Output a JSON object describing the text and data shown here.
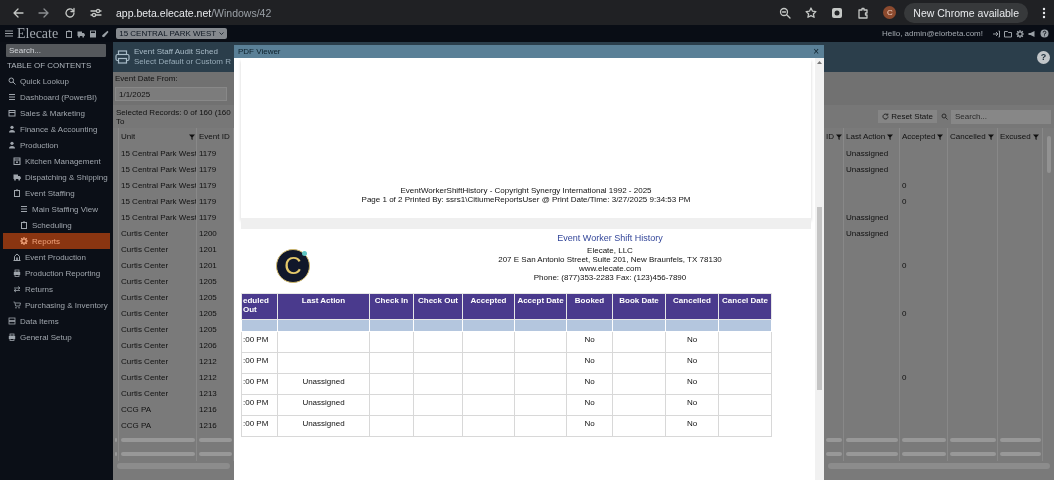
{
  "browser": {
    "address_host": "app.beta.elecate.net",
    "address_path": "/Windows/42",
    "profile_initial": "C",
    "update_button": "New Chrome available"
  },
  "app_header": {
    "logo": "Elecate",
    "location_dropdown": "15 CENTRAL PARK WEST",
    "greeting": "Hello, admin@elorbeta.com!"
  },
  "sidebar": {
    "search_placeholder": "Search...",
    "heading": "TABLE OF CONTENTS",
    "items": [
      {
        "label": "Quick Lookup",
        "selected": false
      },
      {
        "label": "Dashboard (PowerBI)",
        "selected": false
      },
      {
        "label": "Sales & Marketing",
        "selected": false
      },
      {
        "label": "Finance & Accounting",
        "selected": false
      },
      {
        "label": "Production",
        "selected": false,
        "children": [
          {
            "label": "Kitchen Management",
            "selected": false
          },
          {
            "label": "Dispatching & Shipping",
            "selected": false
          },
          {
            "label": "Event Staffing",
            "selected": false,
            "children": [
              {
                "label": "Main Staffing View",
                "selected": false
              },
              {
                "label": "Scheduling",
                "selected": false
              },
              {
                "label": "Reports",
                "selected": true
              }
            ]
          },
          {
            "label": "Event Production",
            "selected": false
          },
          {
            "label": "Production Reporting",
            "selected": false
          },
          {
            "label": "Returns",
            "selected": false
          },
          {
            "label": "Purchasing & Inventory",
            "selected": false
          }
        ]
      },
      {
        "label": "Data Items",
        "selected": false
      },
      {
        "label": "General Setup",
        "selected": false
      }
    ]
  },
  "report": {
    "title": "Event Staff Audit Sched",
    "subtitle": "Select Default or Custom R",
    "help_button": "?",
    "date_filter": {
      "label": "Event Date From:",
      "value": "1/1/2025"
    },
    "records_summary": "Selected Records: 0 of 160 (160 To",
    "reset_button": "Reset State",
    "search_placeholder": "Search...",
    "left_columns": [
      {
        "label": "Unit",
        "filter": true
      },
      {
        "label": "Event ID",
        "filter": false
      }
    ],
    "right_columns": [
      {
        "label": "ID",
        "filter": true
      },
      {
        "label": "Last Action",
        "filter": true
      },
      {
        "label": "Accepted",
        "filter": true
      },
      {
        "label": "Cancelled",
        "filter": true
      },
      {
        "label": "Excused",
        "filter": true
      }
    ],
    "rows": [
      {
        "unit": "15 Central Park West",
        "event_id": "1179",
        "last_action": "Unassigned"
      },
      {
        "unit": "15 Central Park West",
        "event_id": "1179",
        "last_action": "Unassigned"
      },
      {
        "unit": "15 Central Park West",
        "event_id": "1179",
        "accepted": "0"
      },
      {
        "unit": "15 Central Park West",
        "event_id": "1179",
        "accepted": "0"
      },
      {
        "unit": "15 Central Park West",
        "event_id": "1179",
        "last_action": "Unassigned"
      },
      {
        "unit": "Curtis Center",
        "event_id": "1200",
        "last_action": "Unassigned"
      },
      {
        "unit": "Curtis Center",
        "event_id": "1201"
      },
      {
        "unit": "Curtis Center",
        "event_id": "1201",
        "accepted": "0"
      },
      {
        "unit": "Curtis Center",
        "event_id": "1205"
      },
      {
        "unit": "Curtis Center",
        "event_id": "1205"
      },
      {
        "unit": "Curtis Center",
        "event_id": "1205",
        "accepted": "0"
      },
      {
        "unit": "Curtis Center",
        "event_id": "1205"
      },
      {
        "unit": "Curtis Center",
        "event_id": "1206"
      },
      {
        "unit": "Curtis Center",
        "event_id": "1212"
      },
      {
        "unit": "Curtis Center",
        "event_id": "1212",
        "accepted": "0"
      },
      {
        "unit": "Curtis Center",
        "event_id": "1213"
      },
      {
        "unit": "CCG PA",
        "event_id": "1216"
      },
      {
        "unit": "CCG PA",
        "event_id": "1216"
      }
    ]
  },
  "pdf_viewer": {
    "title": "PDF Viewer",
    "close": "×",
    "page_footer": [
      "EventWorkerShiftHistory - Copyright Synergy International 1992 - 2025",
      "Page 1 of 2 Printed By: ssrs1\\CitiumeReportsUser @ Print Date/Time: 3/27/2025 9:34:53 PM"
    ],
    "logo_letter": "C",
    "report_title": "Event Worker Shift History",
    "company_lines": [
      "Elecate, LLC",
      "207 E San Antonio Street, Suite 201, New Braunfels, TX 78130",
      "www.elecate.com",
      "Phone: (877)353-2283 Fax: (123)456-7890"
    ],
    "columns": [
      "eduled Out",
      "Last Action",
      "Check In",
      "Check Out",
      "Accepted",
      "Accept Date",
      "Booked",
      "Book Date",
      "Cancelled",
      "Cancel Date"
    ],
    "rows": [
      {
        "scheduled_out": ":00 PM",
        "booked": "No",
        "cancelled": "No"
      },
      {
        "scheduled_out": ":00 PM",
        "booked": "No",
        "cancelled": "No"
      },
      {
        "scheduled_out": ":00 PM",
        "last_action": "Unassigned",
        "booked": "No",
        "cancelled": "No"
      },
      {
        "scheduled_out": ":00 PM",
        "last_action": "Unassigned",
        "booked": "No",
        "cancelled": "No"
      },
      {
        "scheduled_out": ":00 PM",
        "last_action": "Unassigned",
        "booked": "No",
        "cancelled": "No"
      }
    ]
  }
}
